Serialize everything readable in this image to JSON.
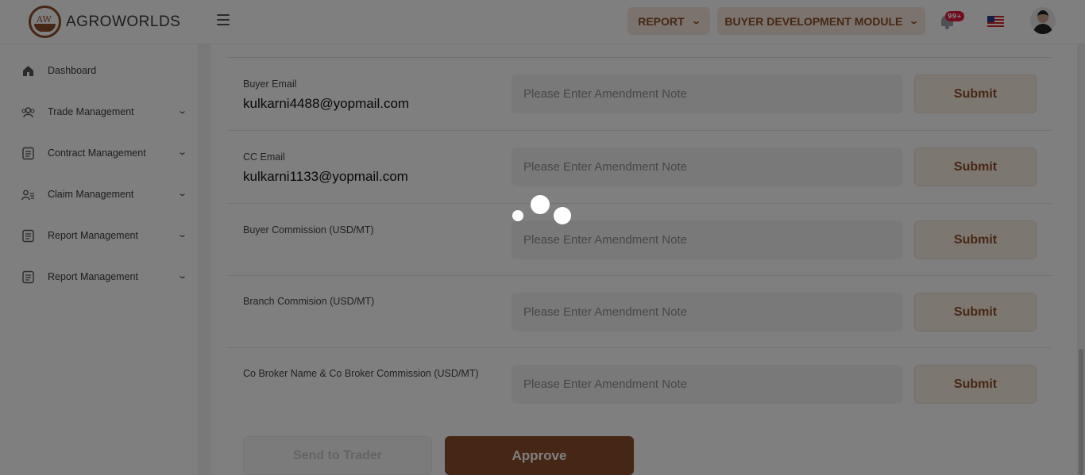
{
  "header": {
    "logo_mark": "AW",
    "logo_text": "AGROWORLDS",
    "report_button": "REPORT",
    "buyer_module_button": "BUYER DEVELOPMENT MODULE",
    "notification_badge": "99+",
    "flag_icon": "us-flag-icon",
    "avatar_icon": "user-avatar-icon"
  },
  "sidebar": {
    "items": [
      {
        "label": "Dashboard",
        "icon": "home-icon"
      },
      {
        "label": "Trade Management",
        "icon": "users-icon"
      },
      {
        "label": "Contract Management",
        "icon": "document-icon"
      },
      {
        "label": "Claim Management",
        "icon": "user-list-icon"
      },
      {
        "label": "Report Management",
        "icon": "document-icon"
      },
      {
        "label": "Report Management",
        "icon": "document-icon"
      }
    ]
  },
  "form": {
    "rows": [
      {
        "label": "Buyer Email",
        "value": "kulkarni4488@yopmail.com",
        "placeholder": "Please Enter Amendment Note",
        "button": "Submit"
      },
      {
        "label": "CC Email",
        "value": "kulkarni1133@yopmail.com",
        "placeholder": "Please Enter Amendment Note",
        "button": "Submit"
      },
      {
        "label": "Buyer Commission (USD/MT)",
        "value": "",
        "placeholder": "Please Enter Amendment Note",
        "button": "Submit"
      },
      {
        "label": "Branch Commision (USD/MT)",
        "value": "",
        "placeholder": "Please Enter Amendment Note",
        "button": "Submit"
      },
      {
        "label": "Co Broker Name & Co Broker Commission (USD/MT)",
        "value": "",
        "placeholder": "Please Enter Amendment Note",
        "button": "Submit"
      }
    ],
    "send_to_trader": "Send to Trader",
    "approve": "Approve"
  },
  "colors": {
    "brand": "#8c4e2a",
    "brand_light": "#fbeee4",
    "overlay": "rgba(0,0,0,0.5)"
  },
  "loading_spinner": "three-dot-loader"
}
